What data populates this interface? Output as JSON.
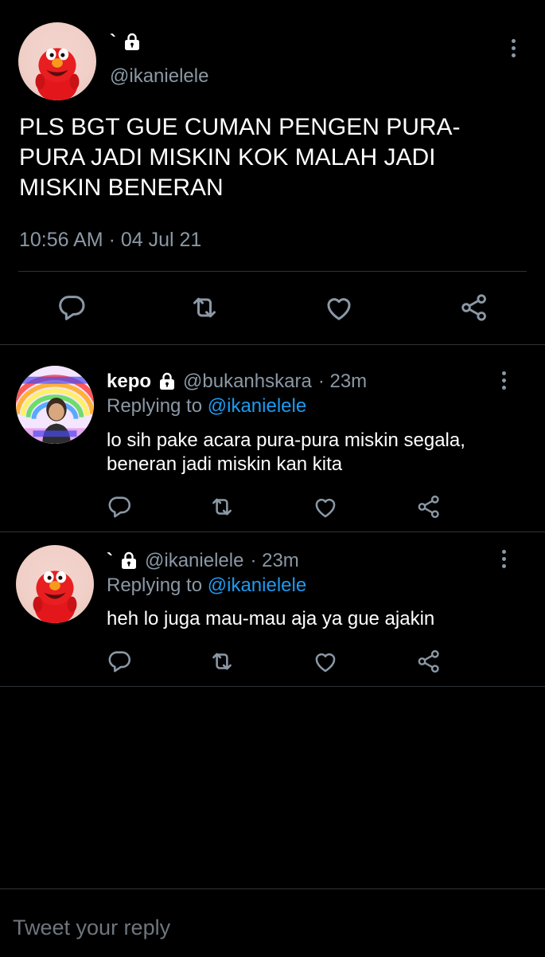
{
  "main_tweet": {
    "user_name": "`",
    "handle": "@ikanielele",
    "text": "PLS BGT GUE CUMAN PENGEN PURA-PURA JADI MISKIN KOK MALAH JADI MISKIN BENERAN",
    "timestamp": "10:56 AM · 04 Jul 21",
    "avatar": "elmo-avatar",
    "locked": true
  },
  "replies": [
    {
      "user_name": "kepo",
      "handle": "@bukanhskara",
      "time": "· 23m",
      "replying_prefix": "Replying to",
      "replying_to": "@ikanielele",
      "text": "lo sih pake acara pura-pura miskin segala, beneran jadi miskin kan kita",
      "avatar": "rainbow-photo-avatar",
      "locked": true
    },
    {
      "user_name": "`",
      "handle": "@ikanielele",
      "time": "· 23m",
      "replying_prefix": "Replying to",
      "replying_to": "@ikanielele",
      "text": "heh lo juga mau-mau aja ya gue ajakin",
      "avatar": "elmo-avatar",
      "locked": true
    }
  ],
  "compose": {
    "placeholder": "Tweet your reply"
  },
  "icons": {
    "reply": "reply-icon",
    "retweet": "retweet-icon",
    "like": "like-icon",
    "share": "share-icon",
    "more": "more-icon",
    "lock": "lock-icon"
  },
  "colors": {
    "background": "#000000",
    "text": "#ffffff",
    "muted": "#8b98a5",
    "link": "#1d9bf0",
    "divider": "#2f3336",
    "placeholder": "#6e767d"
  }
}
